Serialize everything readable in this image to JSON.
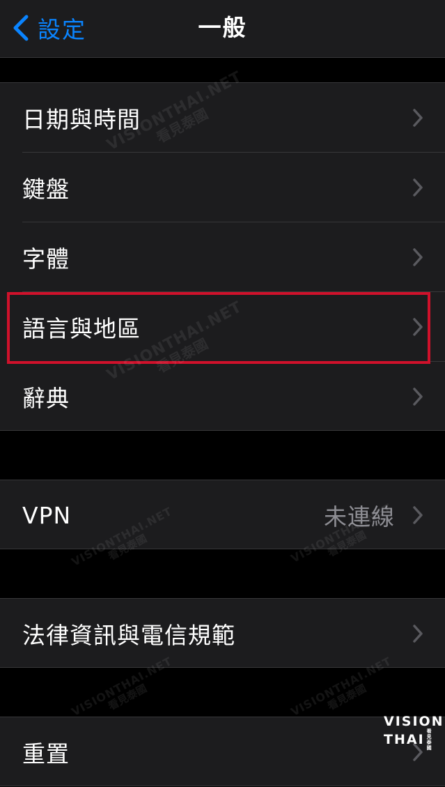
{
  "nav": {
    "back_label": "設定",
    "title": "一般"
  },
  "group1": {
    "items": [
      {
        "label": "日期與時間"
      },
      {
        "label": "鍵盤"
      },
      {
        "label": "字體"
      },
      {
        "label": "語言與地區"
      },
      {
        "label": "辭典"
      }
    ]
  },
  "group2": {
    "items": [
      {
        "label": "VPN",
        "value": "未連線"
      }
    ]
  },
  "group3": {
    "items": [
      {
        "label": "法律資訊與電信規範"
      }
    ]
  },
  "group4": {
    "items": [
      {
        "label": "重置"
      }
    ]
  },
  "highlight": {
    "target": "語言與地區",
    "color": "#d0112b"
  },
  "watermark": {
    "main": "VISIONTHAI.NET",
    "sub": "看見泰國"
  },
  "logo": {
    "line1": "VISION",
    "line2": "THAI",
    "sub": "看見泰國"
  },
  "colors": {
    "accent": "#0a84ff",
    "background": "#000000",
    "cell": "#1c1c1e",
    "separator": "#38383a",
    "secondary_text": "#8d8d93"
  },
  "icons": {
    "back": "chevron-left-icon",
    "disclosure": "chevron-right-icon"
  }
}
